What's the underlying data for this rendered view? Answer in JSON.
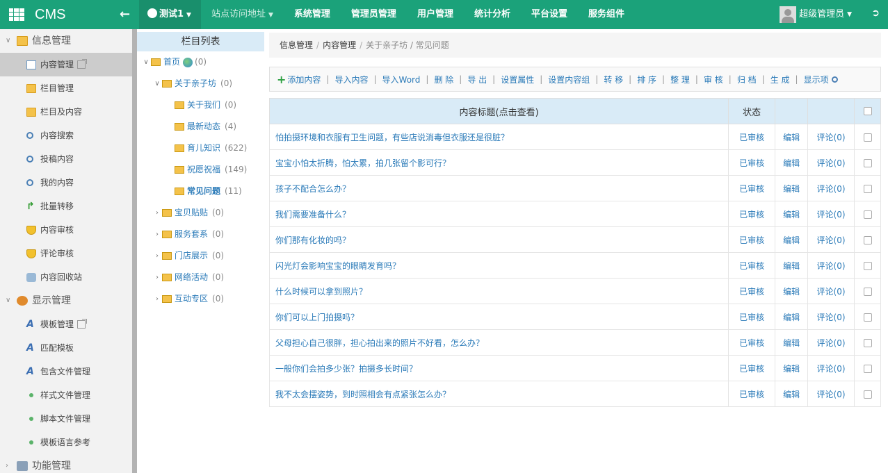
{
  "app": {
    "logo": "CMS",
    "back_icon": "arrow-left-icon"
  },
  "nav": {
    "site": "测试1",
    "items": [
      "站点访问地址",
      "系统管理",
      "管理员管理",
      "用户管理",
      "统计分析",
      "平台设置",
      "服务组件"
    ]
  },
  "user": {
    "name": "超级管理员"
  },
  "sidebar": {
    "group1": "信息管理",
    "group1_items": [
      "内容管理",
      "栏目管理",
      "栏目及内容",
      "内容搜索",
      "投稿内容",
      "我的内容",
      "批量转移",
      "内容审核",
      "评论审核",
      "内容回收站"
    ],
    "group2": "显示管理",
    "group2_items": [
      "模板管理",
      "匹配模板",
      "包含文件管理",
      "样式文件管理",
      "脚本文件管理",
      "模板语言参考"
    ],
    "group3": "功能管理"
  },
  "tree": {
    "header": "栏目列表",
    "root": {
      "label": "首页",
      "count": "(0)"
    },
    "about": {
      "label": "关于亲子坊",
      "count": "(0)"
    },
    "about_children": [
      {
        "label": "关于我们",
        "count": "(0)"
      },
      {
        "label": "最新动态",
        "count": "(4)"
      },
      {
        "label": "育儿知识",
        "count": "(622)"
      },
      {
        "label": "祝愿祝福",
        "count": "(149)"
      },
      {
        "label": "常见问题",
        "count": "(11)"
      }
    ],
    "siblings": [
      {
        "label": "宝贝贴贴",
        "count": "(0)"
      },
      {
        "label": "服务套系",
        "count": "(0)"
      },
      {
        "label": "门店展示",
        "count": "(0)"
      },
      {
        "label": "网络活动",
        "count": "(0)"
      },
      {
        "label": "互动专区",
        "count": "(0)"
      }
    ]
  },
  "breadcrumb": {
    "a": "信息管理",
    "b": "内容管理",
    "c": "关于亲子坊 / 常见问题"
  },
  "toolbar": [
    "添加内容",
    "导入内容",
    "导入Word",
    "删 除",
    "导 出",
    "设置属性",
    "设置内容组",
    "转 移",
    "排 序",
    "整 理",
    "审 核",
    "归 档",
    "生 成",
    "显示项"
  ],
  "table": {
    "headers": {
      "title": "内容标题(点击查看)",
      "status": "状态"
    },
    "rows": [
      {
        "title": "怕拍摄环境和衣服有卫生问题，有些店说消毒但衣服还是很脏？",
        "status": "已审核",
        "edit": "编辑",
        "comment": "评论(0)"
      },
      {
        "title": "宝宝小怕太折腾，怕太累，拍几张留个影可行？",
        "status": "已审核",
        "edit": "编辑",
        "comment": "评论(0)"
      },
      {
        "title": "孩子不配合怎么办？",
        "status": "已审核",
        "edit": "编辑",
        "comment": "评论(0)"
      },
      {
        "title": "我们需要准备什么？",
        "status": "已审核",
        "edit": "编辑",
        "comment": "评论(0)"
      },
      {
        "title": "你们那有化妆的吗？",
        "status": "已审核",
        "edit": "编辑",
        "comment": "评论(0)"
      },
      {
        "title": "闪光灯会影响宝宝的眼睛发育吗？",
        "status": "已审核",
        "edit": "编辑",
        "comment": "评论(0)"
      },
      {
        "title": "什么时候可以拿到照片？",
        "status": "已审核",
        "edit": "编辑",
        "comment": "评论(0)"
      },
      {
        "title": "你们可以上门拍摄吗？",
        "status": "已审核",
        "edit": "编辑",
        "comment": "评论(0)"
      },
      {
        "title": "父母担心自己很胖，担心拍出来的照片不好看，怎么办？",
        "status": "已审核",
        "edit": "编辑",
        "comment": "评论(0)"
      },
      {
        "title": "一般你们会拍多少张？拍摄多长时间？",
        "status": "已审核",
        "edit": "编辑",
        "comment": "评论(0)"
      },
      {
        "title": "我不太会摆姿势，到时照相会有点紧张怎么办？",
        "status": "已审核",
        "edit": "编辑",
        "comment": "评论(0)"
      }
    ]
  }
}
